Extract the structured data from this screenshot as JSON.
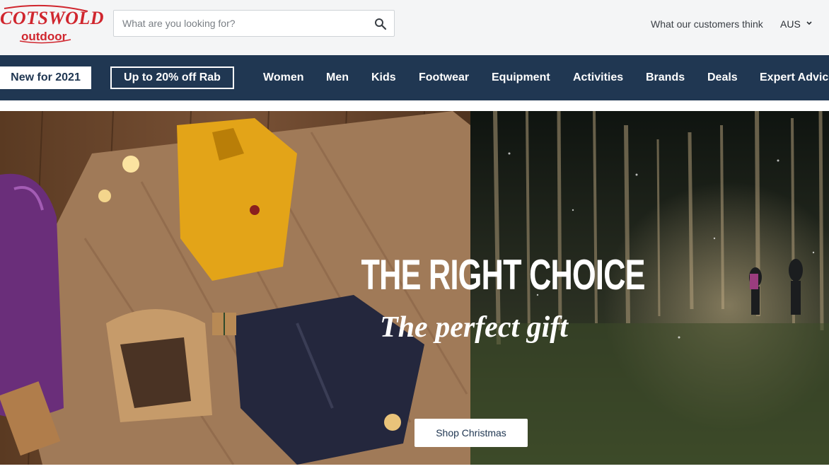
{
  "header": {
    "logo": {
      "brand": "COTSWOLD",
      "sub": "outdoor",
      "color": "#d0262e"
    },
    "search": {
      "placeholder": "What are you looking for?",
      "value": "",
      "icon": "search-icon"
    },
    "reviews_link": "What our customers think",
    "country": {
      "selected": "AUS",
      "icon": "chevron-down-icon"
    }
  },
  "nav": {
    "background": "#203752",
    "promo_new": "New for 2021",
    "promo_rab": "Up to 20% off Rab",
    "items": [
      {
        "label": "Women"
      },
      {
        "label": "Men"
      },
      {
        "label": "Kids"
      },
      {
        "label": "Footwear"
      },
      {
        "label": "Equipment"
      },
      {
        "label": "Activities"
      },
      {
        "label": "Brands"
      },
      {
        "label": "Deals"
      },
      {
        "label": "Expert Advice"
      }
    ]
  },
  "hero": {
    "headline": "THE RIGHT CHOICE",
    "tagline": "The perfect gift",
    "cta": "Shop Christmas"
  }
}
